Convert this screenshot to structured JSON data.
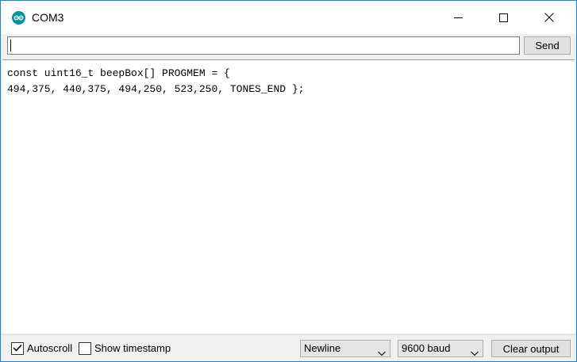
{
  "window": {
    "title": "COM3",
    "icon": "arduino-icon",
    "controls": [
      "minimize-icon",
      "maximize-icon",
      "close-icon"
    ]
  },
  "input": {
    "value": "",
    "send_label": "Send"
  },
  "output": {
    "lines": [
      "const uint16_t beepBox[] PROGMEM = {",
      "494,375, 440,375, 494,250, 523,250, TONES_END };"
    ]
  },
  "footer": {
    "autoscroll_label": "Autoscroll",
    "autoscroll_checked": true,
    "timestamp_label": "Show timestamp",
    "timestamp_checked": false,
    "line_ending": "Newline",
    "baud_rate": "9600 baud",
    "clear_label": "Clear output"
  },
  "colors": {
    "accent": "#1883d7",
    "arduino": "#00979c"
  }
}
